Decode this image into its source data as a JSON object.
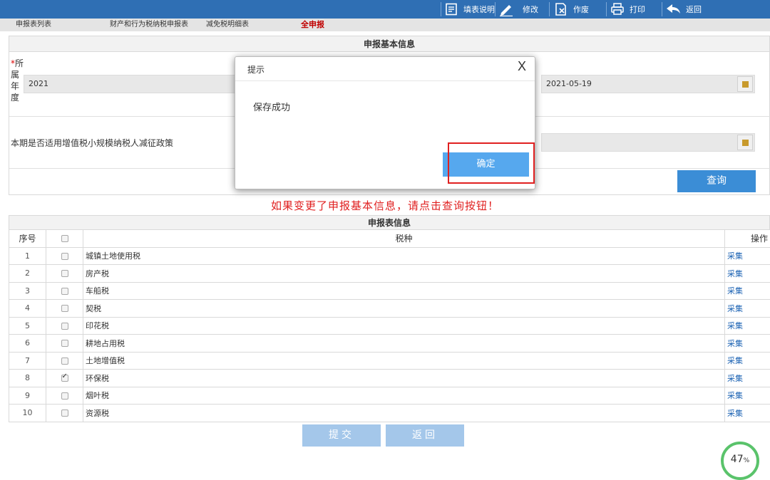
{
  "toolbar": {
    "fill_guide": "填表说明",
    "modify": "修改",
    "void": "作废",
    "print": "打印",
    "back": "返回"
  },
  "tabs": [
    {
      "label": "申报表列表",
      "active": false
    },
    {
      "label": "财产和行为税纳税申报表",
      "active": false
    },
    {
      "label": "减免税明细表",
      "active": false
    },
    {
      "label": "全申报",
      "active": true
    }
  ],
  "basic_info": {
    "title": "申报基本信息",
    "year_label": "所属年度",
    "year_label_chars": [
      "所",
      "属",
      "年",
      "度"
    ],
    "year_value": "2021",
    "date_value": "2021-05-19",
    "policy_label": "本期是否适用增值税小规模纳税人减征政策",
    "query_button": "查询"
  },
  "hint": "如果变更了申报基本信息，请点击查询按钮！",
  "table": {
    "title": "申报表信息",
    "columns": {
      "index": "序号",
      "tax_type": "税种",
      "action": "操作"
    },
    "rows": [
      {
        "index": "1",
        "tax_type": "城镇土地使用税",
        "checked": false,
        "action": "采集"
      },
      {
        "index": "2",
        "tax_type": "房产税",
        "checked": false,
        "action": "采集"
      },
      {
        "index": "3",
        "tax_type": "车船税",
        "checked": false,
        "action": "采集"
      },
      {
        "index": "4",
        "tax_type": "契税",
        "checked": false,
        "action": "采集"
      },
      {
        "index": "5",
        "tax_type": "印花税",
        "checked": false,
        "action": "采集"
      },
      {
        "index": "6",
        "tax_type": "耕地占用税",
        "checked": false,
        "action": "采集"
      },
      {
        "index": "7",
        "tax_type": "土地增值税",
        "checked": false,
        "action": "采集"
      },
      {
        "index": "8",
        "tax_type": "环保税",
        "checked": true,
        "action": "采集"
      },
      {
        "index": "9",
        "tax_type": "烟叶税",
        "checked": false,
        "action": "采集"
      },
      {
        "index": "10",
        "tax_type": "资源税",
        "checked": false,
        "action": "采集"
      }
    ]
  },
  "bottom": {
    "submit": "提交",
    "back": "返回"
  },
  "progress": {
    "value": "47",
    "unit": "%"
  },
  "modal": {
    "title": "提示",
    "close": "X",
    "message": "保存成功",
    "ok": "确定"
  },
  "colors": {
    "toolbar": "#2f6fb4",
    "accent": "#3b8dd6",
    "warning": "#e02020"
  }
}
